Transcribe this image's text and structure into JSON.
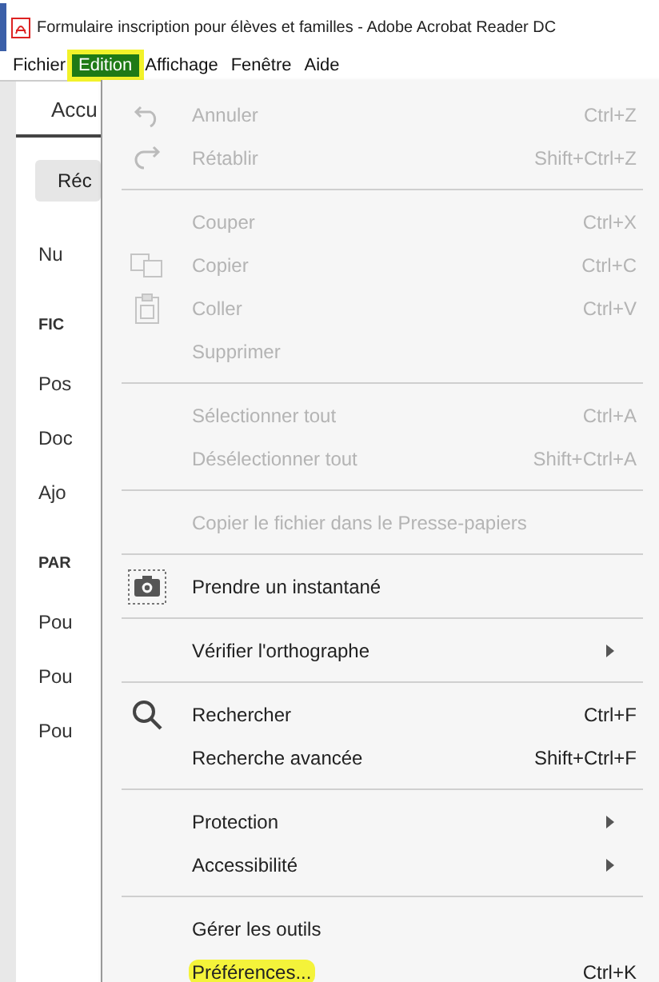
{
  "window": {
    "title": "Formulaire inscription pour élèves et familles - Adobe Acrobat Reader DC"
  },
  "menubar": [
    {
      "label": "Fichier",
      "selected": false
    },
    {
      "label": "Edition",
      "selected": true
    },
    {
      "label": "Affichage",
      "selected": false
    },
    {
      "label": "Fenêtre",
      "selected": false
    },
    {
      "label": "Aide",
      "selected": false
    }
  ],
  "left_panel": {
    "tab": "Accu",
    "items": [
      {
        "kind": "button",
        "label": "Réc"
      },
      {
        "kind": "item",
        "label": "Nu"
      },
      {
        "kind": "heading",
        "label": "FIC"
      },
      {
        "kind": "item",
        "label": "Pos"
      },
      {
        "kind": "item",
        "label": "Doc"
      },
      {
        "kind": "item",
        "label": "Ajo"
      },
      {
        "kind": "heading",
        "label": "PAR"
      },
      {
        "kind": "item",
        "label": "Pou"
      },
      {
        "kind": "item",
        "label": "Pou"
      },
      {
        "kind": "item",
        "label": "Pou"
      }
    ]
  },
  "edit_menu": [
    {
      "kind": "item",
      "label": "Annuler",
      "shortcut": "Ctrl+Z",
      "disabled": true,
      "submenu": false,
      "highlighted": false
    },
    {
      "kind": "item",
      "label": "Rétablir",
      "shortcut": "Shift+Ctrl+Z",
      "disabled": true,
      "submenu": false,
      "highlighted": false
    },
    {
      "kind": "separator"
    },
    {
      "kind": "item",
      "label": "Couper",
      "shortcut": "Ctrl+X",
      "disabled": true,
      "submenu": false,
      "highlighted": false
    },
    {
      "kind": "item",
      "label": "Copier",
      "shortcut": "Ctrl+C",
      "disabled": true,
      "submenu": false,
      "highlighted": false
    },
    {
      "kind": "item",
      "label": "Coller",
      "shortcut": "Ctrl+V",
      "disabled": true,
      "submenu": false,
      "highlighted": false
    },
    {
      "kind": "item",
      "label": "Supprimer",
      "disabled": true,
      "submenu": false,
      "highlighted": false
    },
    {
      "kind": "separator"
    },
    {
      "kind": "item",
      "label": "Sélectionner tout",
      "shortcut": "Ctrl+A",
      "disabled": true,
      "submenu": false,
      "highlighted": false
    },
    {
      "kind": "item",
      "label": "Désélectionner tout",
      "shortcut": "Shift+Ctrl+A",
      "disabled": true,
      "submenu": false,
      "highlighted": false
    },
    {
      "kind": "separator"
    },
    {
      "kind": "item",
      "label": "Copier le fichier dans le Presse-papiers",
      "disabled": true,
      "submenu": false,
      "highlighted": false
    },
    {
      "kind": "separator"
    },
    {
      "kind": "item",
      "label": "Prendre un instantané",
      "disabled": false,
      "submenu": false,
      "highlighted": false
    },
    {
      "kind": "separator"
    },
    {
      "kind": "item",
      "label": "Vérifier l'orthographe",
      "disabled": false,
      "submenu": true,
      "highlighted": false
    },
    {
      "kind": "separator"
    },
    {
      "kind": "item",
      "label": "Rechercher",
      "shortcut": "Ctrl+F",
      "disabled": false,
      "submenu": false,
      "highlighted": false
    },
    {
      "kind": "item",
      "label": "Recherche avancée",
      "shortcut": "Shift+Ctrl+F",
      "disabled": false,
      "submenu": false,
      "highlighted": false
    },
    {
      "kind": "separator"
    },
    {
      "kind": "item",
      "label": "Protection",
      "disabled": false,
      "submenu": true,
      "highlighted": false
    },
    {
      "kind": "item",
      "label": "Accessibilité",
      "disabled": false,
      "submenu": true,
      "highlighted": false
    },
    {
      "kind": "separator"
    },
    {
      "kind": "item",
      "label": "Gérer les outils",
      "disabled": false,
      "submenu": false,
      "highlighted": false
    },
    {
      "kind": "item",
      "label": "Préférences...",
      "shortcut": "Ctrl+K",
      "disabled": false,
      "submenu": false,
      "highlighted": true
    }
  ]
}
